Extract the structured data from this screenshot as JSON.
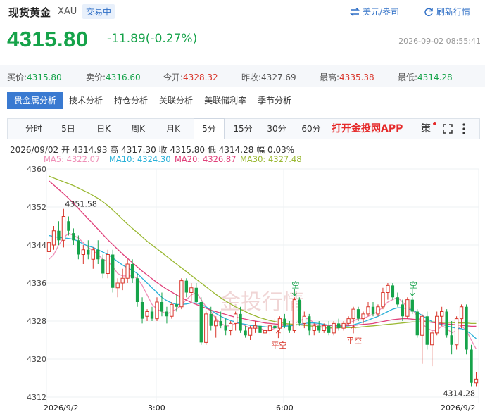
{
  "header": {
    "title": "现货黄金",
    "code": "XAU",
    "status_badge": "交易中",
    "currency_label": "美元/盎司",
    "refresh_label": "刷新行情"
  },
  "quote": {
    "price": "4315.80",
    "change": "-11.89(-0.27%)",
    "datetime": "2026-09-02 08:55:41"
  },
  "stats": [
    {
      "label": "买价:",
      "value": "4315.80",
      "color": "green"
    },
    {
      "label": "卖价:",
      "value": "4316.60",
      "color": "green"
    },
    {
      "label": "今开:",
      "value": "4328.32",
      "color": "red"
    },
    {
      "label": "昨收:",
      "value": "4327.69",
      "color": "gray"
    },
    {
      "label": "最高:",
      "value": "4335.38",
      "color": "red"
    },
    {
      "label": "最低:",
      "value": "4314.28",
      "color": "green"
    }
  ],
  "analysis_tabs": [
    "贵金属分析",
    "技术分析",
    "持仓分析",
    "关联分析",
    "美联储利率",
    "季节分析"
  ],
  "period_tabs": [
    "分时",
    "5日",
    "日K",
    "周K",
    "月K",
    "5分",
    "15分",
    "30分",
    "60分"
  ],
  "active_period": "5分",
  "app_link": "打开金投网APP",
  "toolbar_glyph": "策",
  "bar_info": {
    "date": "2026/09/02",
    "open_label": "开",
    "open": "4314.93",
    "high_label": "高",
    "high": "4317.30",
    "close_label": "收",
    "close": "4315.80",
    "low_label": "低",
    "low": "4314.28",
    "amp_label": "幅",
    "amp": "0.03%"
  },
  "ma_legend": [
    {
      "label": "MA5:",
      "value": "4322.07",
      "color": "#ef8fb7"
    },
    {
      "label": "MA10:",
      "value": "4324.30",
      "color": "#28b0d8"
    },
    {
      "label": "MA20:",
      "value": "4326.87",
      "color": "#e0407a"
    },
    {
      "label": "MA30:",
      "value": "4327.48",
      "color": "#9ab832"
    }
  ],
  "watermark": "金投行情",
  "colors": {
    "up": "#d9362b",
    "down": "#16a34a",
    "accent": "#2f6fc6"
  },
  "chart_data": {
    "type": "candlestick",
    "ylim": [
      4312,
      4360
    ],
    "y_ticks": [
      "4360",
      "4352",
      "4344",
      "4336",
      "4328",
      "4320",
      "4312"
    ],
    "x_ticks": [
      "2026/9/2",
      "3:00",
      "6:00",
      "2026/9/2"
    ],
    "max_label": "4351.58",
    "min_label": "4314.28",
    "annotations": [
      "空",
      "平空",
      "平空",
      "空"
    ],
    "ohlc": [
      [
        4342.6,
        4345.0,
        4340.0,
        4344.5
      ],
      [
        4344.0,
        4348.0,
        4343.0,
        4347.0
      ],
      [
        4347.0,
        4349.0,
        4344.0,
        4345.0
      ],
      [
        4345.0,
        4351.6,
        4343.5,
        4350.0
      ],
      [
        4349.0,
        4350.0,
        4346.0,
        4347.0
      ],
      [
        4346.5,
        4347.5,
        4344.0,
        4345.0
      ],
      [
        4345.0,
        4346.0,
        4341.0,
        4342.0
      ],
      [
        4342.0,
        4344.0,
        4340.0,
        4343.0
      ],
      [
        4343.0,
        4345.0,
        4341.0,
        4342.0
      ],
      [
        4341.0,
        4343.5,
        4339.0,
        4343.0
      ],
      [
        4343.0,
        4345.0,
        4340.0,
        4341.0
      ],
      [
        4341.0,
        4342.0,
        4337.0,
        4338.0
      ],
      [
        4338.0,
        4343.0,
        4337.0,
        4342.0
      ],
      [
        4342.0,
        4343.0,
        4334.0,
        4335.0
      ],
      [
        4335.0,
        4337.0,
        4333.0,
        4336.0
      ],
      [
        4336.0,
        4339.0,
        4334.5,
        4337.0
      ],
      [
        4337.0,
        4341.0,
        4336.0,
        4340.0
      ],
      [
        4340.0,
        4341.0,
        4336.0,
        4337.0
      ],
      [
        4337.0,
        4338.0,
        4331.0,
        4332.0
      ],
      [
        4332.0,
        4333.0,
        4327.5,
        4328.5
      ],
      [
        4329.0,
        4330.5,
        4328.0,
        4330.0
      ],
      [
        4330.0,
        4331.0,
        4328.0,
        4328.5
      ],
      [
        4328.5,
        4333.0,
        4328.0,
        4332.0
      ],
      [
        4332.0,
        4334.0,
        4329.0,
        4330.0
      ],
      [
        4330.0,
        4331.0,
        4327.5,
        4329.0
      ],
      [
        4329.0,
        4332.0,
        4328.5,
        4331.5
      ],
      [
        4331.5,
        4333.5,
        4330.0,
        4331.0
      ],
      [
        4331.0,
        4337.0,
        4330.5,
        4336.5
      ],
      [
        4336.5,
        4337.0,
        4333.0,
        4334.0
      ],
      [
        4334.0,
        4336.0,
        4332.0,
        4335.0
      ],
      [
        4335.0,
        4336.0,
        4331.5,
        4332.0
      ],
      [
        4332.0,
        4333.0,
        4323.0,
        4323.5
      ],
      [
        4323.5,
        4330.0,
        4323.0,
        4329.5
      ],
      [
        4329.5,
        4331.0,
        4326.0,
        4327.0
      ],
      [
        4327.0,
        4329.0,
        4324.5,
        4328.0
      ],
      [
        4328.0,
        4330.0,
        4326.5,
        4327.0
      ],
      [
        4327.0,
        4328.5,
        4325.0,
        4326.0
      ],
      [
        4326.0,
        4328.0,
        4325.0,
        4327.5
      ],
      [
        4327.5,
        4330.0,
        4326.0,
        4329.5
      ],
      [
        4329.5,
        4331.0,
        4325.5,
        4326.0
      ],
      [
        4326.0,
        4327.0,
        4324.5,
        4325.0
      ],
      [
        4325.0,
        4327.0,
        4324.0,
        4326.5
      ],
      [
        4326.5,
        4328.0,
        4325.5,
        4327.0
      ],
      [
        4327.0,
        4328.5,
        4325.0,
        4325.5
      ],
      [
        4325.5,
        4327.0,
        4324.5,
        4326.0
      ],
      [
        4326.0,
        4327.5,
        4325.0,
        4327.0
      ],
      [
        4327.0,
        4328.5,
        4326.0,
        4326.5
      ],
      [
        4326.5,
        4329.0,
        4326.0,
        4328.5
      ],
      [
        4328.5,
        4329.5,
        4326.5,
        4327.0
      ],
      [
        4327.0,
        4328.0,
        4325.5,
        4326.0
      ],
      [
        4326.0,
        4333.0,
        4325.5,
        4332.5
      ],
      [
        4332.5,
        4333.0,
        4327.0,
        4327.5
      ],
      [
        4327.5,
        4330.0,
        4326.5,
        4329.0
      ],
      [
        4329.0,
        4329.5,
        4325.0,
        4326.0
      ],
      [
        4326.0,
        4327.5,
        4325.0,
        4327.0
      ],
      [
        4327.0,
        4328.0,
        4325.5,
        4326.0
      ],
      [
        4326.0,
        4327.5,
        4325.5,
        4327.0
      ],
      [
        4327.0,
        4328.0,
        4325.0,
        4325.5
      ],
      [
        4325.5,
        4328.0,
        4325.0,
        4327.5
      ],
      [
        4327.5,
        4328.5,
        4326.0,
        4326.5
      ],
      [
        4326.5,
        4328.0,
        4326.0,
        4327.5
      ],
      [
        4327.5,
        4329.0,
        4327.0,
        4328.5
      ],
      [
        4328.5,
        4331.0,
        4327.5,
        4330.5
      ],
      [
        4330.5,
        4331.0,
        4328.0,
        4328.5
      ],
      [
        4328.5,
        4330.0,
        4327.5,
        4329.5
      ],
      [
        4329.5,
        4332.0,
        4329.0,
        4331.0
      ],
      [
        4331.0,
        4332.0,
        4329.0,
        4329.5
      ],
      [
        4329.5,
        4331.5,
        4329.0,
        4331.0
      ],
      [
        4331.0,
        4335.0,
        4330.5,
        4334.0
      ],
      [
        4334.0,
        4336.0,
        4332.5,
        4335.5
      ],
      [
        4335.5,
        4336.0,
        4332.5,
        4333.0
      ],
      [
        4333.0,
        4334.0,
        4331.0,
        4331.5
      ],
      [
        4331.5,
        4332.5,
        4328.0,
        4329.0
      ],
      [
        4329.0,
        4333.0,
        4328.5,
        4332.5
      ],
      [
        4332.5,
        4333.0,
        4329.5,
        4330.0
      ],
      [
        4330.0,
        4330.5,
        4324.5,
        4325.0
      ],
      [
        4325.0,
        4329.5,
        4319.0,
        4329.0
      ],
      [
        4329.0,
        4330.0,
        4322.0,
        4323.0
      ],
      [
        4323.0,
        4326.0,
        4318.5,
        4325.5
      ],
      [
        4325.5,
        4330.0,
        4325.0,
        4329.0
      ],
      [
        4329.0,
        4331.0,
        4327.0,
        4330.0
      ],
      [
        4330.0,
        4330.5,
        4324.5,
        4325.0
      ],
      [
        4325.0,
        4328.0,
        4321.0,
        4323.0
      ],
      [
        4323.0,
        4329.0,
        4322.0,
        4328.5
      ],
      [
        4328.5,
        4331.5,
        4326.5,
        4331.0
      ],
      [
        4331.0,
        4331.5,
        4321.0,
        4322.0
      ],
      [
        4322.0,
        4323.0,
        4314.3,
        4315.0
      ],
      [
        4315.0,
        4317.3,
        4314.3,
        4315.8
      ]
    ],
    "series": [
      {
        "name": "MA5",
        "values": [
          4341,
          4342,
          4344,
          4345.5,
          4346.5,
          4346,
          4345.5,
          4344.5,
          4343.5,
          4342.8,
          4342,
          4341,
          4340.5,
          4339.5,
          4338,
          4337.5,
          4337.5,
          4337.5,
          4337,
          4335.5,
          4333.5,
          4331.5,
          4330.5,
          4330,
          4329.5,
          4330,
          4330.5,
          4331.5,
          4332.5,
          4333.5,
          4334,
          4332.5,
          4331,
          4330,
          4328.5,
          4327.5,
          4327,
          4327,
          4327.5,
          4327.5,
          4327,
          4326.5,
          4326.5,
          4326.5,
          4326,
          4326,
          4326.5,
          4327,
          4327,
          4327,
          4327.5,
          4328,
          4328.5,
          4328.5,
          4327.5,
          4327,
          4326.5,
          4326.5,
          4326.5,
          4326.5,
          4327,
          4327.5,
          4328,
          4328.5,
          4328.5,
          4329,
          4329.5,
          4330,
          4331,
          4332,
          4332.5,
          4333,
          4332,
          4331,
          4330.5,
          4329,
          4327.5,
          4326.5,
          4326,
          4326,
          4327,
          4326.5,
          4325.5,
          4326,
          4327,
          4326,
          4324,
          4322.1
        ]
      },
      {
        "name": "MA10",
        "values": [
          4346,
          4345.8,
          4345.6,
          4345.5,
          4345.4,
          4345.2,
          4344.8,
          4344.2,
          4343.8,
          4343.5,
          4343,
          4342.5,
          4342,
          4341.3,
          4340.5,
          4339.8,
          4339.2,
          4338.7,
          4338,
          4337,
          4336,
          4335,
          4334,
          4333,
          4332.3,
          4331.8,
          4331.5,
          4331.5,
          4331.6,
          4331.8,
          4331.8,
          4331.5,
          4331,
          4330.3,
          4329.6,
          4329,
          4328.5,
          4328.1,
          4327.8,
          4327.5,
          4327.3,
          4327.1,
          4327,
          4326.9,
          4326.8,
          4326.7,
          4326.7,
          4326.8,
          4326.9,
          4327,
          4327.1,
          4327.3,
          4327.5,
          4327.6,
          4327.6,
          4327.5,
          4327.3,
          4327.1,
          4327,
          4326.9,
          4326.9,
          4327,
          4327.2,
          4327.5,
          4327.8,
          4328.2,
          4328.6,
          4329,
          4329.5,
          4330,
          4330.5,
          4330.8,
          4330.8,
          4330.6,
          4330.3,
          4329.8,
          4329.2,
          4328.5,
          4327.9,
          4327.5,
          4327.3,
          4327,
          4326.7,
          4326.5,
          4326.4,
          4326,
          4325.2,
          4324.3
        ]
      },
      {
        "name": "MA20",
        "values": [
          4357.5,
          4356.6,
          4355.7,
          4354.8,
          4353.8,
          4352.8,
          4351.7,
          4350.6,
          4349.5,
          4348.4,
          4347.3,
          4346.2,
          4345.1,
          4344.1,
          4343.1,
          4342.1,
          4341.2,
          4340.3,
          4339.4,
          4338.5,
          4337.7,
          4336.9,
          4336.1,
          4335.4,
          4334.7,
          4334.1,
          4333.5,
          4332.9,
          4332.4,
          4331.9,
          4331.5,
          4331.1,
          4330.7,
          4330.3,
          4330,
          4329.7,
          4329.4,
          4329.1,
          4328.8,
          4328.6,
          4328.4,
          4328.2,
          4328,
          4327.8,
          4327.6,
          4327.5,
          4327.4,
          4327.3,
          4327.2,
          4327.2,
          4327.2,
          4327.2,
          4327.2,
          4327.2,
          4327.2,
          4327.2,
          4327.1,
          4327.1,
          4327.1,
          4327.1,
          4327.1,
          4327.1,
          4327.1,
          4327.2,
          4327.3,
          4327.4,
          4327.5,
          4327.7,
          4327.9,
          4328.1,
          4328.3,
          4328.4,
          4328.5,
          4328.5,
          4328.4,
          4328.3,
          4328.1,
          4327.9,
          4327.7,
          4327.6,
          4327.5,
          4327.4,
          4327.3,
          4327.2,
          4327.1,
          4327,
          4326.9,
          4326.9
        ]
      },
      {
        "name": "MA30",
        "values": [
          4358.5,
          4358.1,
          4357.7,
          4357.3,
          4356.9,
          4356.5,
          4356,
          4355.5,
          4355,
          4354.4,
          4353.8,
          4353.1,
          4352.3,
          4351.4,
          4350.4,
          4349.4,
          4348.4,
          4347.5,
          4346.6,
          4345.7,
          4344.8,
          4344,
          4343.2,
          4342.4,
          4341.6,
          4340.8,
          4340,
          4339.2,
          4338.4,
          4337.6,
          4336.8,
          4336,
          4335.2,
          4334.4,
          4333.6,
          4332.9,
          4332.2,
          4331.6,
          4331,
          4330.5,
          4330,
          4329.5,
          4329.1,
          4328.7,
          4328.4,
          4328.1,
          4327.9,
          4327.7,
          4327.5,
          4327.4,
          4327.3,
          4327.2,
          4327.1,
          4327,
          4326.9,
          4326.8,
          4326.7,
          4326.6,
          4326.6,
          4326.6,
          4326.6,
          4326.6,
          4326.6,
          4326.7,
          4326.8,
          4326.9,
          4327,
          4327.1,
          4327.2,
          4327.3,
          4327.4,
          4327.5,
          4327.6,
          4327.7,
          4327.8,
          4327.8,
          4327.8,
          4327.8,
          4327.8,
          4327.8,
          4327.7,
          4327.7,
          4327.7,
          4327.6,
          4327.6,
          4327.6,
          4327.5,
          4327.5
        ]
      }
    ]
  }
}
